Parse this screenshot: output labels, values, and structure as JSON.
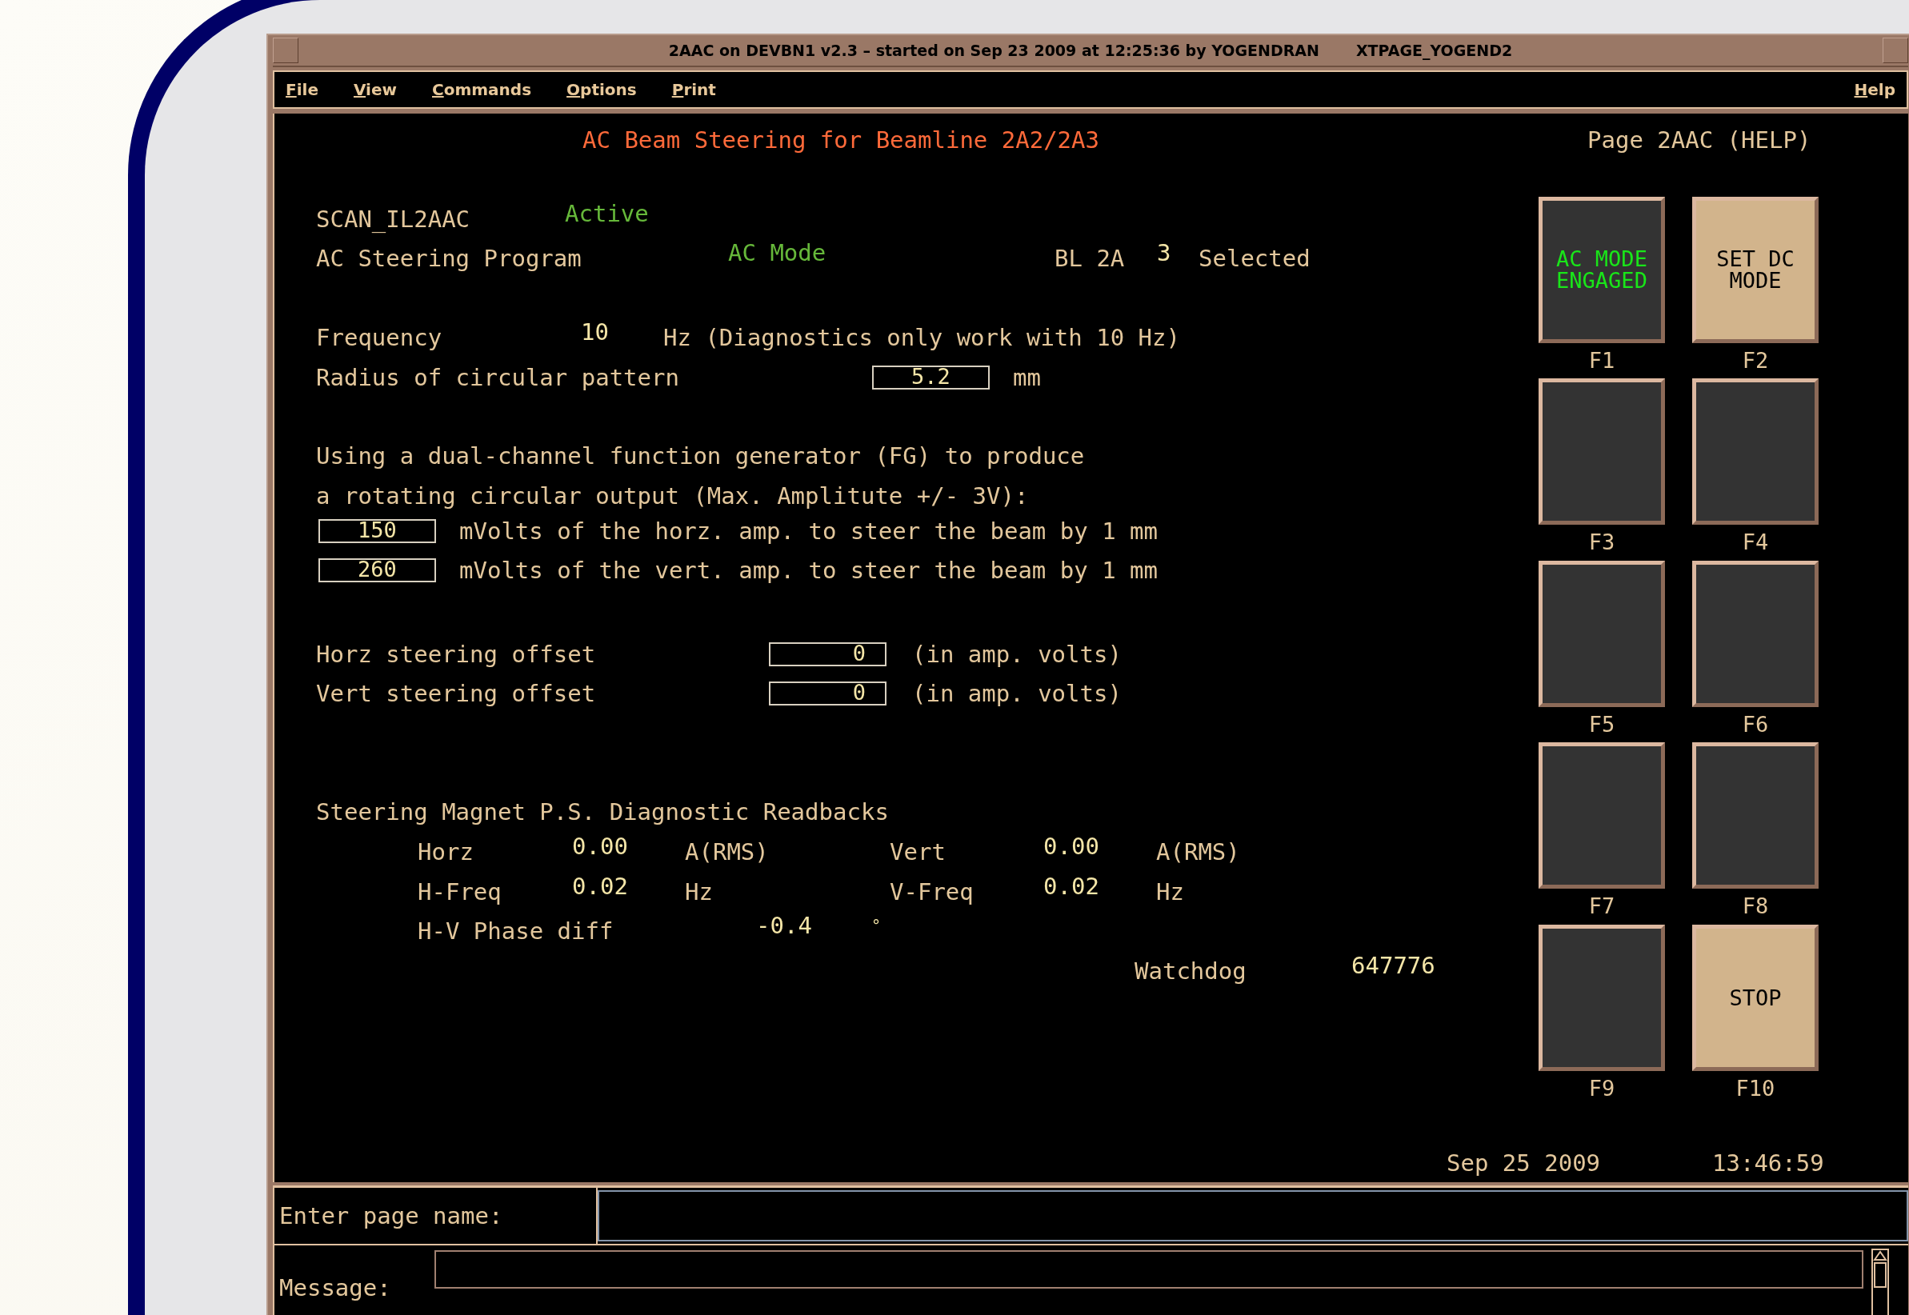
{
  "window": {
    "title": "2AAC on DEVBN1 v2.3 – started on Sep 23 2009 at 12:25:36 by YOGENDRAN",
    "display_name": "XTPAGE_YOGEND2"
  },
  "menu": [
    {
      "label": "File"
    },
    {
      "label": "View"
    },
    {
      "label": "Commands"
    },
    {
      "label": "Options"
    },
    {
      "label": "Print"
    }
  ],
  "help_menu": "Help",
  "page": {
    "title": "AC Beam Steering for Beamline 2A2/2A3",
    "page_id": "Page 2AAC (HELP)"
  },
  "status": {
    "program_name": "SCAN_IL2AAC",
    "program_state": "Active",
    "steering_label": "AC Steering Program",
    "mode": "AC Mode",
    "beamline": "BL 2A",
    "beamline_number": "3",
    "beamline_state": "Selected"
  },
  "frequency": {
    "label": "Frequency",
    "value": "10",
    "note": "Hz (Diagnostics only work with 10 Hz)"
  },
  "radius": {
    "label": "Radius of circular pattern",
    "value": "5.2",
    "unit": "mm"
  },
  "description": [
    "Using a dual-channel function generator (FG) to produce",
    "a rotating circular output (Max. Amplitute +/- 3V):"
  ],
  "amplitudes": [
    {
      "value": "150",
      "label": "mVolts of the horz. amp. to steer the beam by 1 mm"
    },
    {
      "value": "260",
      "label": "mVolts of the vert. amp. to steer the beam by 1 mm"
    }
  ],
  "offsets": [
    {
      "label": "Horz steering offset",
      "value": "0",
      "unit": "(in amp. volts)"
    },
    {
      "label": "Vert steering offset",
      "value": "0",
      "unit": "(in amp. volts)"
    }
  ],
  "readbacks": {
    "title": "Steering Magnet P.S. Diagnostic Readbacks",
    "rows": [
      {
        "label": "Horz",
        "value": "0.00",
        "unit": "A(RMS)",
        "label_2": "Vert",
        "value_2": "0.00",
        "unit_2": "A(RMS)"
      },
      {
        "label": "H-Freq",
        "value": "0.02",
        "unit": "Hz",
        "label_2": "V-Freq",
        "value_2": "0.02",
        "unit_2": "Hz"
      }
    ],
    "phase": {
      "label": "H-V Phase diff",
      "value": "-0.4",
      "unit": "°"
    },
    "watchdog": {
      "label": "Watchdog",
      "value": "647776"
    }
  },
  "function_keys": [
    {
      "label": "AC MODE\nENGAGED",
      "kind": "engaged"
    },
    {
      "label": "SET DC\nMODE",
      "kind": "action"
    },
    {
      "kind": "blank"
    },
    {
      "kind": "blank"
    },
    {
      "kind": "blank"
    },
    {
      "kind": "blank"
    },
    {
      "kind": "blank"
    },
    {
      "kind": "blank"
    },
    {
      "kind": "blank"
    },
    {
      "label": "STOP",
      "kind": "action"
    }
  ],
  "function_key_names": [
    "F1",
    "F2",
    "F3",
    "F4",
    "F5",
    "F6",
    "F7",
    "F8",
    "F9",
    "F10"
  ],
  "date": "Sep 25 2009",
  "time": "13:46:59",
  "command": {
    "label": "Enter page name:"
  },
  "message": {
    "label": "Message:"
  }
}
